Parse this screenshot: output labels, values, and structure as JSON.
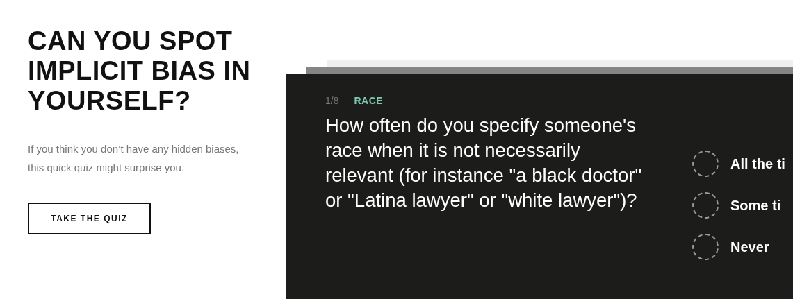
{
  "intro": {
    "title": "CAN YOU SPOT IMPLICIT BIAS IN YOURSELF?",
    "subtitle": "If you think you don’t have any hidden biases, this quick quiz might surprise you.",
    "button": "TAKE THE QUIZ"
  },
  "quiz": {
    "progress": "1/8",
    "category": "RACE",
    "question": "How often do you specify someone's race when it is not necessarily relevant (for instance \"a black doctor\" or \"Latina lawyer\" or \"white lawyer\")?",
    "options": [
      {
        "label": "All the ti",
        "selected": false
      },
      {
        "label": "Some ti",
        "selected": false
      },
      {
        "label": "Never",
        "selected": false
      }
    ]
  }
}
